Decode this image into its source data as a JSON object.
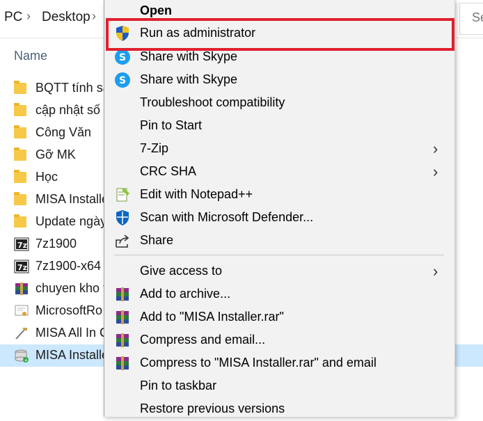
{
  "explorer": {
    "breadcrumb": [
      "PC",
      "Desktop"
    ],
    "search_placeholder": "Se",
    "column_name": "Name",
    "files": [
      {
        "name": "BQTT tính sa",
        "type": "folder"
      },
      {
        "name": "cập nhật số",
        "type": "folder"
      },
      {
        "name": "Công Văn",
        "type": "folder"
      },
      {
        "name": "Gỡ MK",
        "type": "folder"
      },
      {
        "name": "Học",
        "type": "folder"
      },
      {
        "name": "MISA Installe",
        "type": "folder"
      },
      {
        "name": "Update ngày",
        "type": "folder"
      },
      {
        "name": "7z1900",
        "type": "7zip-exe"
      },
      {
        "name": "7z1900-x64",
        "type": "7zip-exe"
      },
      {
        "name": "chuyen kho t",
        "type": "rar"
      },
      {
        "name": "MicrosoftRo",
        "type": "certificate"
      },
      {
        "name": "MISA All In C",
        "type": "tool"
      },
      {
        "name": "MISA Installe",
        "type": "installer",
        "selected": true
      }
    ]
  },
  "context_menu": {
    "items": [
      {
        "label": "Open",
        "bold": true,
        "icon": "none"
      },
      {
        "label": "Run as administrator",
        "icon": "uac-shield-icon"
      },
      {
        "label": "Share with Skype",
        "icon": "skype-icon"
      },
      {
        "label": "Share with Skype",
        "icon": "skype-icon"
      },
      {
        "label": "Troubleshoot compatibility",
        "icon": "none"
      },
      {
        "label": "Pin to Start",
        "icon": "none"
      },
      {
        "label": "7-Zip",
        "icon": "none",
        "submenu": true
      },
      {
        "label": "CRC SHA",
        "icon": "none",
        "submenu": true
      },
      {
        "label": "Edit with Notepad++",
        "icon": "notepadpp-icon"
      },
      {
        "label": "Scan with Microsoft Defender...",
        "icon": "defender-icon"
      },
      {
        "label": "Share",
        "icon": "share-icon"
      },
      {
        "label": "Give access to",
        "icon": "none",
        "submenu": true
      },
      {
        "label": "Add to archive...",
        "icon": "winrar-icon"
      },
      {
        "label": "Add to \"MISA Installer.rar\"",
        "icon": "winrar-icon"
      },
      {
        "label": "Compress and email...",
        "icon": "winrar-icon"
      },
      {
        "label": "Compress to \"MISA Installer.rar\" and email",
        "icon": "winrar-icon"
      },
      {
        "label": "Pin to taskbar",
        "icon": "none"
      },
      {
        "label": "Restore previous versions",
        "icon": "none"
      }
    ],
    "highlight_color": "#e0202e"
  }
}
